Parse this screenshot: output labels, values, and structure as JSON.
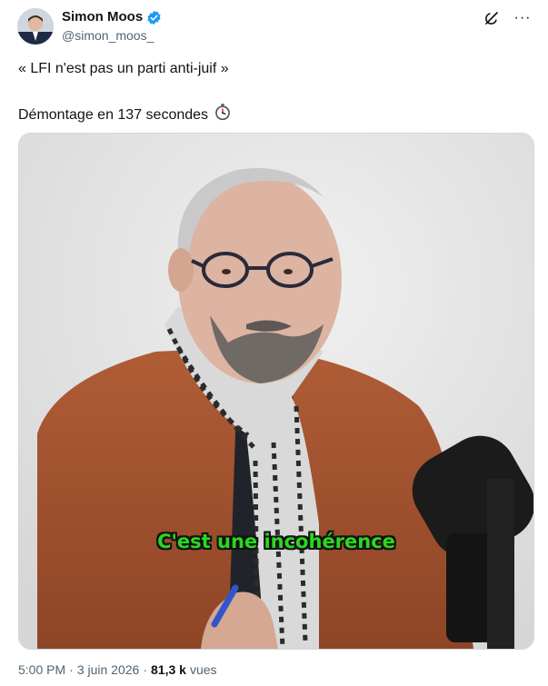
{
  "author": {
    "name": "Simon Moos",
    "handle": "@simon_moos_"
  },
  "tweet": {
    "line1": "« LFI n'est pas un parti anti-juif »",
    "line2": "Démontage en 137 secondes",
    "line2_emoji": "⏱"
  },
  "video": {
    "caption": "C'est une incohérence"
  },
  "meta": {
    "time": "5:00 PM",
    "sep1": "·",
    "date": "3 juin 2026",
    "sep2": "·",
    "views": "81,3 k",
    "views_label": "vues"
  },
  "colors": {
    "verified": "#1d9bf0",
    "caption": "#2bd81d",
    "jacket": "#a4532f"
  },
  "icons": {
    "verified": "verified-badge-icon",
    "grok": "grok-icon",
    "more": "more-options-icon",
    "timer": "stopwatch-icon"
  }
}
